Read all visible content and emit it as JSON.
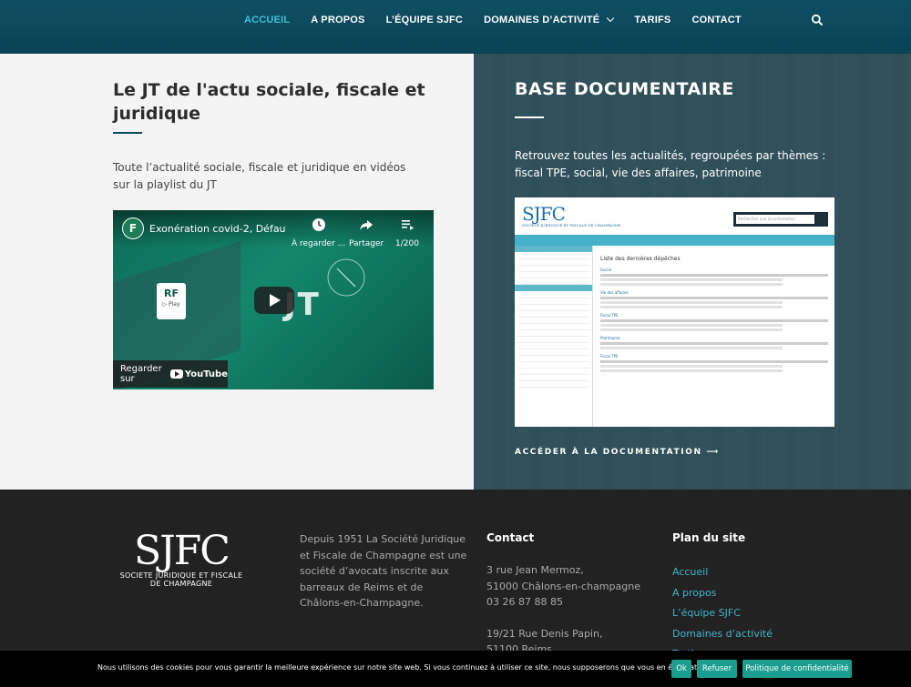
{
  "nav": {
    "items": [
      {
        "label": "ACCUEIL",
        "active": true
      },
      {
        "label": "A PROPOS"
      },
      {
        "label": "L’ÉQUIPE SJFC"
      },
      {
        "label": "DOMAINES D’ACTIVITÉ",
        "dropdown": true
      },
      {
        "label": "TARIFS"
      },
      {
        "label": "CONTACT"
      }
    ],
    "search_icon": "search-icon"
  },
  "jt": {
    "title": "Le JT de l'actu sociale, fiscale et juridique",
    "description": "Toute l’actualité sociale, fiscale et juridique en vidéos sur la playlist du JT",
    "video": {
      "channel_letter": "F",
      "title": "Exonération covid-2, Défaut...",
      "watch_later": "À regarder ...",
      "share": "Partager",
      "playlist_count": "1/200",
      "rf_logo": "RF",
      "rf_sub": "▷ Play",
      "jt_text": "JT",
      "watch_on": "Regarder sur",
      "youtube": "YouTube"
    }
  },
  "base": {
    "title": "BASE DOCUMENTAIRE",
    "description": "Retrouvez toutes les actualités, regroupées par thèmes : fiscal TPE, social, vie des affaires, patrimoine",
    "screenshot": {
      "logo": "SJFC",
      "logo_sub": "SOCIETE JURIDIQUE ET FISCALE DE CHAMPAGNE",
      "search_placeholder": "Rechercher une documentation",
      "list_title": "Liste des dernières dépêches",
      "categories": [
        "Social",
        "Vie des affaires",
        "Fiscal TPE",
        "Patrimoine",
        "Fiscal TPE"
      ]
    },
    "link": "ACCÉDER À LA DOCUMENTATION ⟶"
  },
  "footer": {
    "logo_big": "SJFC",
    "logo_sub1": "SOCIETE JURIDIQUE ET FISCALE",
    "logo_sub2": "DE CHAMPAGNE",
    "about": "Depuis 1951 La Société Juridique et Fiscale de Champagne est une société d’avocats inscrite aux barreaux de Reims et de Châlons-en-Champagne.",
    "contact_title": "Contact",
    "contact_lines": [
      "3 rue Jean Mermoz,",
      "51000 Châlons-en-champagne",
      "03 26 87 88 85"
    ],
    "contact_lines2": [
      "19/21 Rue Denis Papin,",
      "51100 Reims"
    ],
    "plan_title": "Plan du site",
    "plan_links": [
      "Accueil",
      "A propos",
      "L’équipe SJFC",
      "Domaines d’activité",
      "Tarifs"
    ]
  },
  "cookie": {
    "message": "Nous utilisons des cookies pour vous garantir la meilleure expérience sur notre site web. Si vous continuez à utiliser ce site, nous supposerons que vous en êtes satisfait.",
    "ok": "Ok",
    "refuse": "Refuser",
    "policy": "Politique de confidentialité"
  },
  "colors": {
    "nav_bg": "#0a4354",
    "accent": "#3fc0d8",
    "footer_bg": "#222222",
    "cookie_button": "#1a9e8f"
  }
}
